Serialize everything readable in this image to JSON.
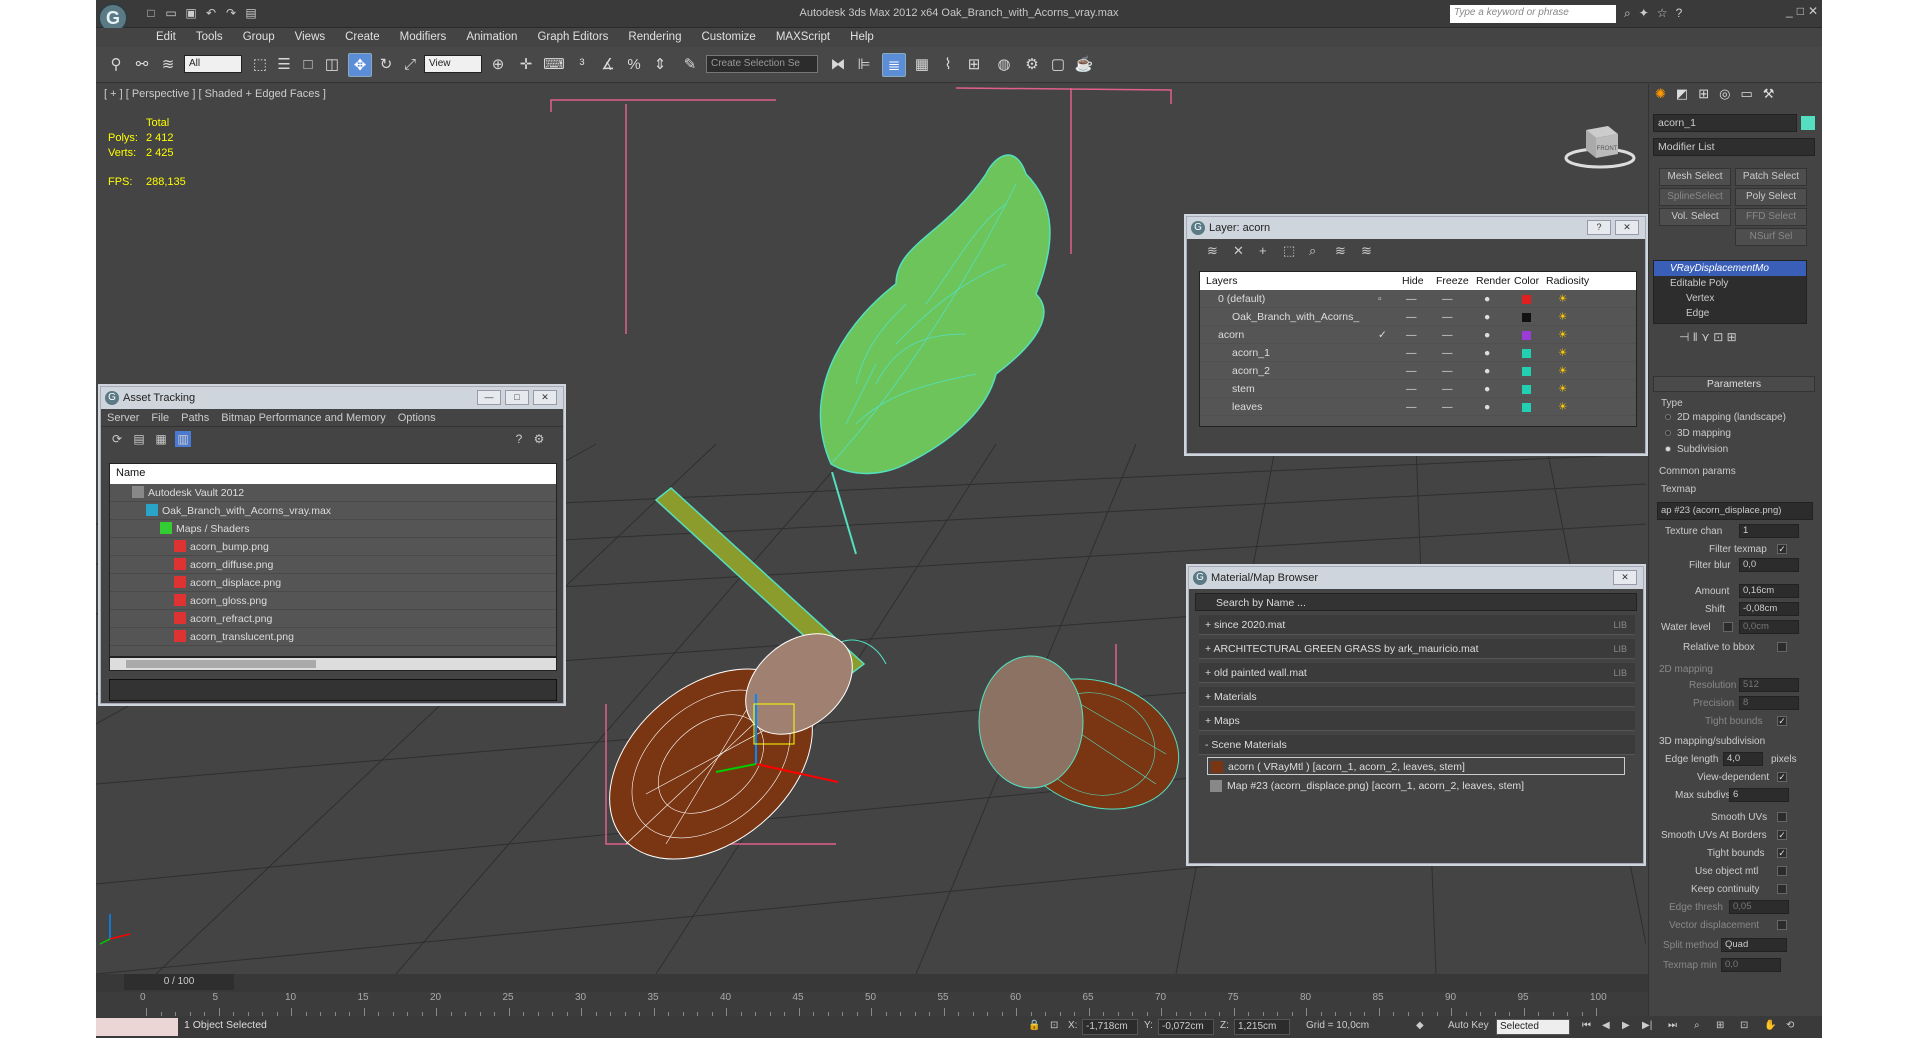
{
  "app": {
    "title": "Autodesk 3ds Max  2012 x64      Oak_Branch_with_Acorns_vray.max",
    "search_placeholder": "Type a keyword or phrase"
  },
  "menu": [
    "Edit",
    "Tools",
    "Group",
    "Views",
    "Create",
    "Modifiers",
    "Animation",
    "Graph Editors",
    "Rendering",
    "Customize",
    "MAXScript",
    "Help"
  ],
  "toolbar": {
    "selection_filter": "All",
    "ref_coord": "View",
    "named_selection": "Create Selection Se"
  },
  "viewport": {
    "label": "[ + ] [ Perspective ] [ Shaded + Edged Faces ]",
    "stats": {
      "header": "Total",
      "polys_label": "Polys:",
      "polys": "2 412",
      "verts_label": "Verts:",
      "verts": "2 425",
      "fps_label": "FPS:",
      "fps": "288,135"
    },
    "viewcube": "FRONT"
  },
  "asset_tracking": {
    "title": "Asset Tracking",
    "menu": [
      "Server",
      "File",
      "Paths",
      "Bitmap Performance and Memory",
      "Options"
    ],
    "column": "Name",
    "rows": [
      "Autodesk Vault 2012",
      "Oak_Branch_with_Acorns_vray.max",
      "Maps / Shaders",
      "acorn_bump.png",
      "acorn_diffuse.png",
      "acorn_displace.png",
      "acorn_gloss.png",
      "acorn_refract.png",
      "acorn_translucent.png"
    ]
  },
  "layer": {
    "title": "Layer: acorn",
    "headers": [
      "Layers",
      "Hide",
      "Freeze",
      "Render",
      "Color",
      "Radiosity"
    ],
    "rows": [
      {
        "name": "0 (default)",
        "color": "#e02020"
      },
      {
        "name": "Oak_Branch_with_Acorns_",
        "color": "#111111"
      },
      {
        "name": "acorn",
        "color": "#9c3cd8"
      },
      {
        "name": "acorn_1",
        "color": "#20d0b0"
      },
      {
        "name": "acorn_2",
        "color": "#20d0b0"
      },
      {
        "name": "stem",
        "color": "#20d0b0"
      },
      {
        "name": "leaves",
        "color": "#20d0b0"
      }
    ]
  },
  "material_browser": {
    "title": "Material/Map Browser",
    "search": "Search by Name ...",
    "libraries": [
      {
        "label": "+ since 2020.mat",
        "tag": "LIB"
      },
      {
        "label": "+ ARCHITECTURAL GREEN GRASS by ark_mauricio.mat",
        "tag": "LIB"
      },
      {
        "label": "+ old painted wall.mat",
        "tag": "LIB"
      }
    ],
    "groups": [
      "+ Materials",
      "+ Maps",
      "- Scene Materials"
    ],
    "scene_items": [
      "acorn  ( VRayMtl )  [acorn_1, acorn_2, leaves, stem]",
      "Map #23 (acorn_displace.png)  [acorn_1, acorn_2, leaves, stem]"
    ]
  },
  "command_panel": {
    "object_name": "acorn_1",
    "modifier_list": "Modifier List",
    "buttons": [
      "Mesh Select",
      "Patch Select",
      "SplineSelect",
      "Poly Select",
      "Vol. Select",
      "FFD Select",
      "NSurf Sel"
    ],
    "stack": [
      "VRayDisplacementMo",
      "Editable Poly",
      "Vertex",
      "Edge"
    ],
    "parameters_title": "Parameters",
    "type_label": "Type",
    "type_options": [
      "2D mapping (landscape)",
      "3D mapping",
      "Subdivision"
    ],
    "common_params": "Common params",
    "texmap_label": "Texmap",
    "texmap_value": "ap #23 (acorn_displace.png)",
    "texture_chan_label": "Texture chan",
    "texture_chan": "1",
    "filter_texmap": "Filter texmap",
    "filter_blur_label": "Filter blur",
    "filter_blur": "0,0",
    "amount_label": "Amount",
    "amount": "0,16cm",
    "shift_label": "Shift",
    "shift": "-0,08cm",
    "water_level_label": "Water level",
    "water_level": "0,0cm",
    "relative_bbox": "Relative to bbox",
    "mapping2d": "2D mapping",
    "resolution_label": "Resolution",
    "resolution": "512",
    "precision_label": "Precision",
    "precision": "8",
    "tight_bounds": "Tight bounds",
    "sub3d": "3D mapping/subdivision",
    "edge_length_label": "Edge length",
    "edge_length": "4,0",
    "pixels": "pixels",
    "view_dependent": "View-dependent",
    "max_subdivs_label": "Max subdivs",
    "max_subdivs": "6",
    "smooth_uvs": "Smooth UVs",
    "smooth_uvs_borders": "Smooth UVs At Borders",
    "tight_bounds2": "Tight bounds",
    "use_object_mtl": "Use object mtl",
    "keep_continuity": "Keep continuity",
    "edge_thresh_label": "Edge thresh",
    "edge_thresh": "0,05",
    "vector_disp": "Vector displacement",
    "split_method_label": "Split method",
    "split_method": "Quad",
    "texmap_min_label": "Texmap min",
    "texmap_min": "0,0"
  },
  "timeline": {
    "slider": "0 / 100",
    "ticks": [
      "0",
      "5",
      "10",
      "15",
      "20",
      "25",
      "30",
      "35",
      "40",
      "45",
      "50",
      "55",
      "60",
      "65",
      "70",
      "75",
      "80",
      "85",
      "90",
      "95",
      "100"
    ]
  },
  "status": {
    "selected": "1 Object Selected",
    "x_label": "X:",
    "x": "-1,718cm",
    "y_label": "Y:",
    "y": "-0,072cm",
    "z_label": "Z:",
    "z": "1,215cm",
    "grid": "Grid = 10,0cm",
    "auto_key": "Auto Key",
    "key_mode": "Selected"
  },
  "colors": {
    "accent": "#5b8ed6",
    "stats": "#ffff00",
    "wire": "#54e0c0",
    "bbox": "#e0608a"
  }
}
